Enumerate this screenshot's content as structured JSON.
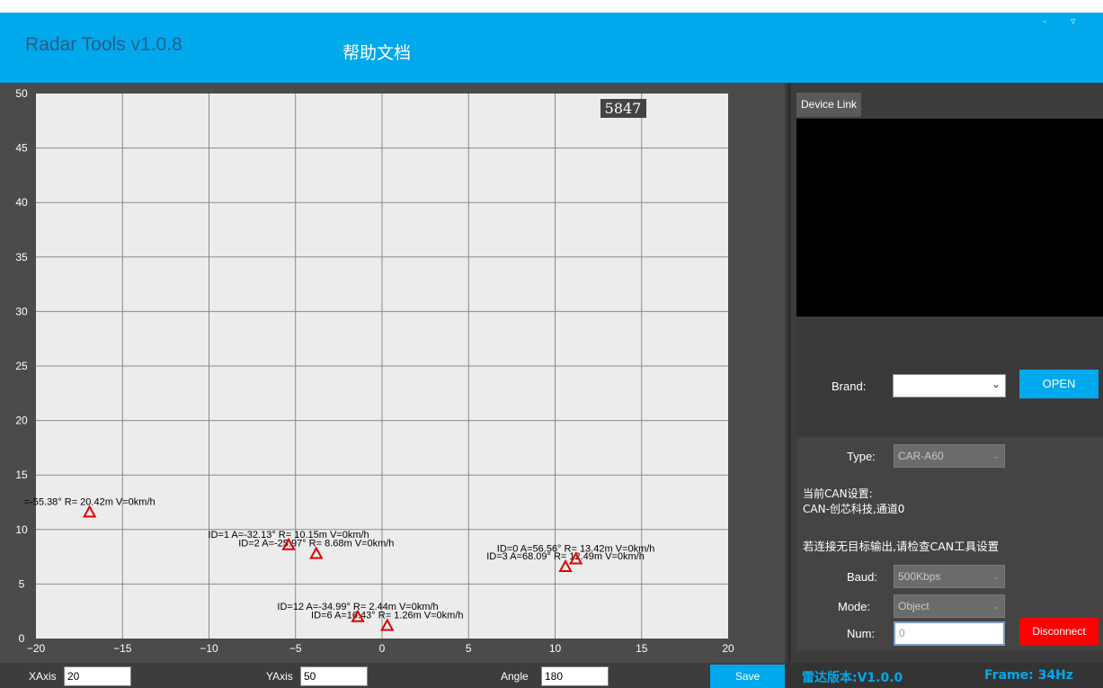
{
  "titlebar": {
    "app_title": "Radar Tools v1.0.8",
    "help_doc": "帮助文档",
    "minimize_glyph": "-",
    "dropdown_glyph": "▿"
  },
  "chart_data": {
    "type": "scatter",
    "xlim": [
      -20,
      20
    ],
    "ylim": [
      0,
      50
    ],
    "x_ticks": [
      -20,
      -15,
      -10,
      -5,
      0,
      5,
      10,
      15,
      20
    ],
    "y_ticks": [
      0,
      5,
      10,
      15,
      20,
      25,
      30,
      35,
      40,
      45,
      50
    ],
    "grid": true,
    "counter": "5847",
    "marker_color": "#e00000",
    "points": [
      {
        "x": -16.9,
        "y": 11.6,
        "label": "=-55.38° R= 20.42m V=0km/h"
      },
      {
        "x": -5.4,
        "y": 8.6,
        "label": "ID=1 A=-32.13° R= 10.15m V=0km/h"
      },
      {
        "x": -3.8,
        "y": 7.8,
        "label": "ID=2 A=-25.97° R= 8.68m V=0km/h"
      },
      {
        "x": 11.2,
        "y": 7.3,
        "label": "ID=0 A=56.56° R= 13.42m V=0km/h"
      },
      {
        "x": 10.6,
        "y": 6.6,
        "label": "ID=3 A=68.09° R= 12.49m V=0km/h"
      },
      {
        "x": -1.4,
        "y": 2.0,
        "label": "ID=12 A=-34.99° R= 2.44m V=0km/h"
      },
      {
        "x": 0.3,
        "y": 1.2,
        "label": "ID=6 A=16.43° R= 1.26m V=0km/h"
      }
    ]
  },
  "right_panel": {
    "tab_label": "Device Link",
    "brand_label": "Brand:",
    "brand_value": "",
    "open_label": "OPEN",
    "type_label": "Type:",
    "type_value": "CAR-A60",
    "can_title": "当前CAN设置:",
    "can_value": "CAN-创芯科技,通道0",
    "hint": "若连接无目标输出,请检查CAN工具设置",
    "baud_label": "Baud:",
    "baud_value": "500Kbps",
    "mode_label": "Mode:",
    "mode_value": "Object",
    "num_label": "Num:",
    "num_value": "0",
    "disconnect_label": "Disconnect"
  },
  "bottom_bar": {
    "xaxis_label": "XAxis",
    "xaxis_value": "20",
    "yaxis_label": "YAxis",
    "yaxis_value": "50",
    "angle_label": "Angle",
    "angle_value": "180",
    "save_label": "Save"
  },
  "footer": {
    "radar_version": "雷达版本:V1.0.0",
    "frame_rate": "Frame:  34Hz"
  },
  "colors": {
    "accent": "#00a8ec",
    "disconnect": "#ff0000",
    "marker": "#e00000"
  }
}
